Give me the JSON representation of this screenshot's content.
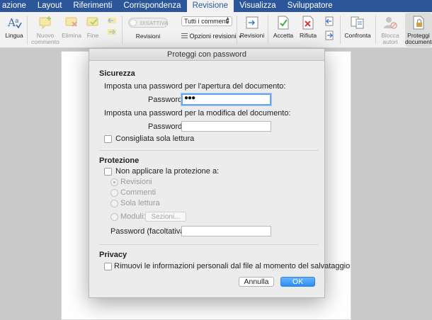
{
  "tabs": [
    {
      "label": "azione",
      "active": false
    },
    {
      "label": "Layout",
      "active": false
    },
    {
      "label": "Riferimenti",
      "active": false
    },
    {
      "label": "Corrispondenza",
      "active": false
    },
    {
      "label": "Revisione",
      "active": true
    },
    {
      "label": "Visualizza",
      "active": false
    },
    {
      "label": "Sviluppatore",
      "active": false
    }
  ],
  "ribbon": {
    "lingua": "Lingua",
    "nuovo_commento_1": "Nuovo",
    "nuovo_commento_2": "commento",
    "elimina": "Elimina",
    "fine": "Fine",
    "toggle": "DISATTIVA",
    "revisioni_label": "Revisioni",
    "combo_value": "Tutti i commenti",
    "opzioni_revisioni": "Opzioni revisioni",
    "revisioni_button": "Revisioni",
    "accetta": "Accetta",
    "rifiuta": "Rifiuta",
    "confronta": "Confronta",
    "blocca_autori_1": "Blocca",
    "blocca_autori_2": "autori",
    "proteggi_1": "Proteggi",
    "proteggi_2": "documento"
  },
  "colors": {
    "accent": "#2b579a",
    "ok_button": "#2a8df6"
  },
  "dialog": {
    "title": "Proteggi con password",
    "sicurezza": {
      "heading": "Sicurezza",
      "open_desc": "Imposta una password per l'apertura del documento:",
      "open_label": "Password:",
      "open_value": "●●●",
      "modify_desc": "Imposta una password per la modifica del documento:",
      "modify_label": "Password:",
      "modify_value": "",
      "readonly": "Consigliata sola lettura"
    },
    "protezione": {
      "heading": "Protezione",
      "no_protect": "Non applicare la protezione a:",
      "options": [
        "Revisioni",
        "Commenti",
        "Sola lettura",
        "Moduli:"
      ],
      "selected_option": "Revisioni",
      "sezioni_button": "Sezioni...",
      "optional_label": "Password (facoltativa):"
    },
    "privacy": {
      "heading": "Privacy",
      "remove_info": "Rimuovi le informazioni personali dal file al momento del salvataggio"
    },
    "cancel_label": "Annulla",
    "ok_label": "OK"
  }
}
